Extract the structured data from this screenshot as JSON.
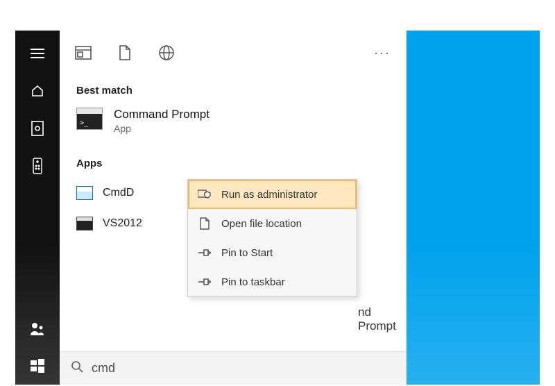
{
  "sections": {
    "best_match": "Best match",
    "apps": "Apps"
  },
  "best_match_result": {
    "title": "Command Prompt",
    "subtitle": "App"
  },
  "app_results": {
    "item1": "CmdD",
    "item2": "VS2012",
    "item2_trail": "nd Prompt"
  },
  "context_menu": {
    "run_admin": "Run as administrator",
    "open_loc": "Open file location",
    "pin_start": "Pin to Start",
    "pin_taskbar": "Pin to taskbar"
  },
  "search": {
    "value": "cmd"
  },
  "more": "···"
}
